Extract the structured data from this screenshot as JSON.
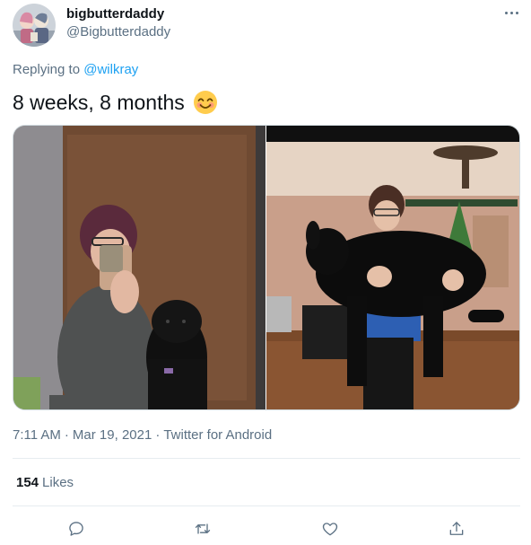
{
  "tweet": {
    "author": {
      "display_name": "bigbutterdaddy",
      "handle": "@Bigbutterdaddy",
      "avatar_icon": "avatar-illustration"
    },
    "more_icon": "more-options-icon",
    "replying_prefix": "Replying to",
    "replying_to": "@wilkray",
    "text": "8 weeks, 8 months",
    "emoji": "smiling-face-with-smiling-eyes",
    "media": [
      {
        "alt": "Selfie in mirror holding phone, black puppy sitting beside"
      },
      {
        "alt": "Person holding a large black dog in a living room with Christmas tree"
      }
    ],
    "timestamp": {
      "time": "7:11 AM",
      "separator": "·",
      "date": "Mar 19, 2021",
      "source": "Twitter for Android"
    },
    "stats": {
      "likes_count": "154",
      "likes_label": "Likes"
    },
    "actions": [
      {
        "name": "reply",
        "icon": "reply-icon"
      },
      {
        "name": "retweet",
        "icon": "retweet-icon"
      },
      {
        "name": "like",
        "icon": "heart-icon"
      },
      {
        "name": "share",
        "icon": "share-icon"
      }
    ],
    "colors": {
      "link": "#1da1f2",
      "secondary_text": "#5b7083",
      "primary_text": "#0f1419",
      "border": "#cfd9de"
    }
  }
}
